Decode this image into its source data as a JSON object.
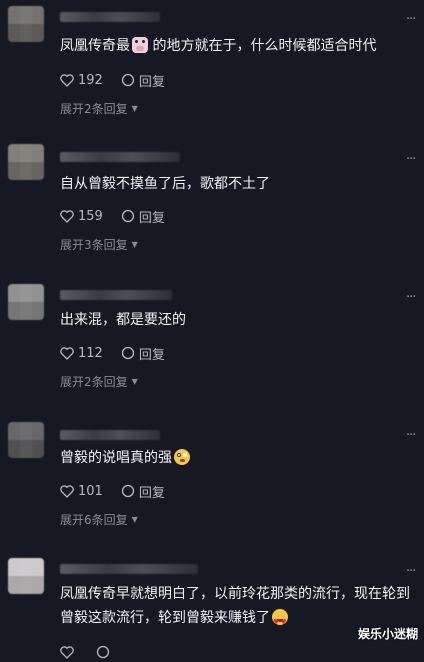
{
  "comments": [
    {
      "text": "凤凰传奇最",
      "text_after_emoji": " 的地方就在于，什么时候都适合时代",
      "emoji": "cow-face",
      "likes": "192",
      "reply_label": "回复",
      "expand_label": "展开2条回复"
    },
    {
      "text": "自从曾毅不摸鱼了后，歌都不土了",
      "likes": "159",
      "reply_label": "回复",
      "expand_label": "展开3条回复"
    },
    {
      "text": "出来混，都是要还的",
      "likes": "112",
      "reply_label": "回复",
      "expand_label": "展开2条回复"
    },
    {
      "text": "曾毅的说唱真的强",
      "emoji": "flushed-face",
      "likes": "101",
      "reply_label": "回复",
      "expand_label": "展开6条回复"
    },
    {
      "text_line1": "凤凰传奇早就想明白了，以前玲花那类的流行，现在轮到",
      "text_line2": "曾毅这款流行，轮到曾毅来赚钱了",
      "emoji": "heart-eyes-face"
    }
  ],
  "more_glyph": "···",
  "watermark": "娱乐小迷糊",
  "colors": {
    "background": "#161823",
    "text": "#f2f2f4",
    "secondary": "#8a8b93"
  }
}
